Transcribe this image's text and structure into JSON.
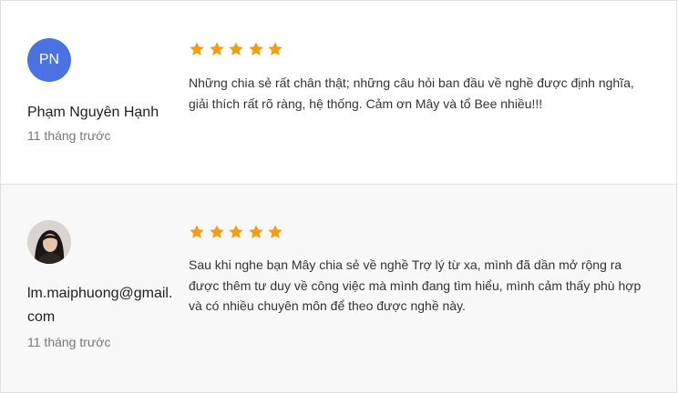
{
  "reviews": [
    {
      "avatar_initials": "PN",
      "avatar_color": "#4b72e2",
      "author": "Phạm Nguyên Hạnh",
      "time": "11 tháng trước",
      "rating": 5,
      "text": "Những chia sẻ rất chân thật; những câu hỏi ban đầu về nghề được định nghĩa, giải thích rất rõ ràng, hệ thống. Cảm ơn Mây và tổ Bee nhiều!!!"
    },
    {
      "avatar_type": "photo",
      "author": "lm.maiphuong@gmail.com",
      "time": "11 tháng trước",
      "rating": 5,
      "text": "Sau khi nghe bạn Mây chia sẻ về nghề Trợ lý từ xa, mình đã dần mở rộng ra được thêm tư duy về công việc mà mình đang tìm hiểu, mình cảm thấy phù hợp và có nhiều chuyên môn để theo được nghề này."
    }
  ],
  "colors": {
    "star": "#f29d12"
  }
}
